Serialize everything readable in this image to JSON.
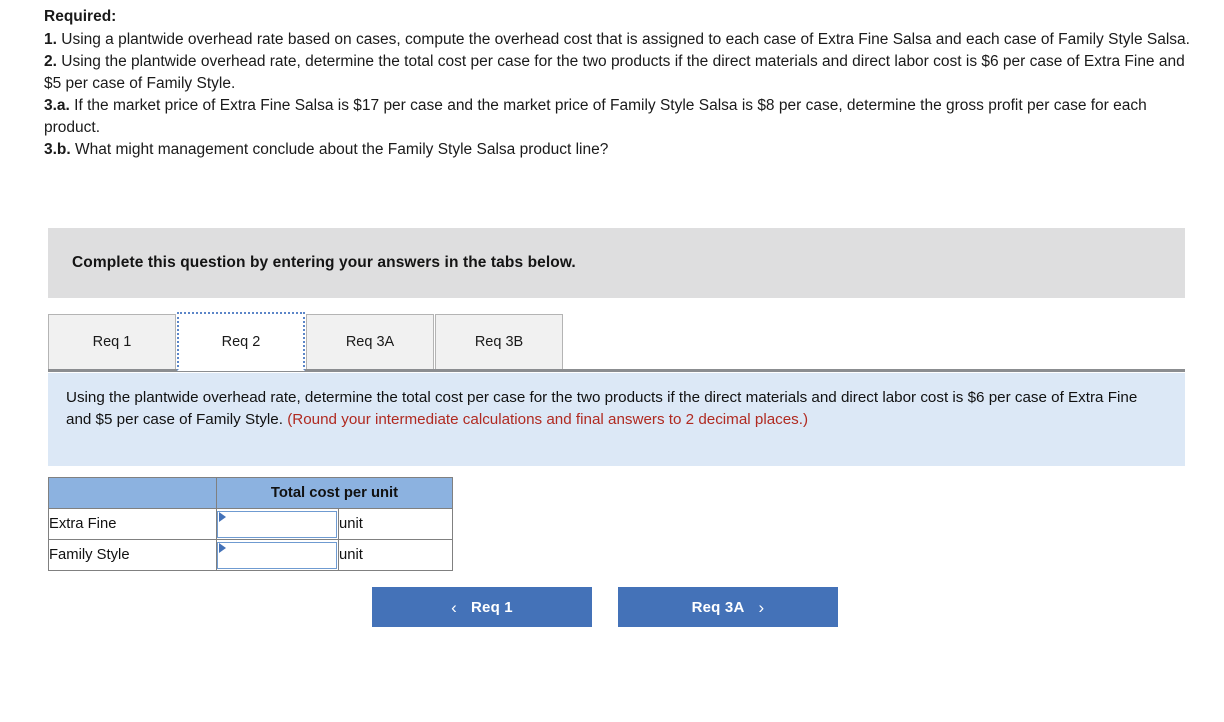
{
  "required": {
    "heading": "Required:",
    "lines": [
      {
        "num": "1.",
        "text": " Using a plantwide overhead rate based on cases, compute the overhead cost that is assigned to each case of Extra Fine Salsa and each case of Family Style Salsa."
      },
      {
        "num": "2.",
        "text": " Using the plantwide overhead rate, determine the total cost per case for the two products if the direct materials and direct labor cost is $6 per case of Extra Fine and $5 per case of Family Style."
      },
      {
        "num": "3.a.",
        "text": " If the market price of Extra Fine Salsa is $17 per case and the market price of Family Style Salsa is $8 per case, determine the gross profit per case for each product."
      },
      {
        "num": "3.b.",
        "text": " What might management conclude about the Family Style Salsa product line?"
      }
    ]
  },
  "banner": {
    "text": "Complete this question by entering your answers in the tabs below."
  },
  "tabs": [
    {
      "label": "Req 1",
      "active": false
    },
    {
      "label": "Req 2",
      "active": true
    },
    {
      "label": "Req 3A",
      "active": false
    },
    {
      "label": "Req 3B",
      "active": false
    }
  ],
  "question_panel": {
    "text_main": "Using the plantwide overhead rate, determine the total cost per case for the two products if the direct materials and direct labor cost is $6 per case of Extra Fine and $5 per case of Family Style.",
    "text_note": "(Round your intermediate calculations and final answers to 2 decimal places.)"
  },
  "answer_table": {
    "header_blank": "",
    "header_total": "Total cost per unit",
    "rows": [
      {
        "label": "Extra Fine",
        "value": "",
        "unit": "unit"
      },
      {
        "label": "Family Style",
        "value": "",
        "unit": "unit"
      }
    ]
  },
  "nav": {
    "prev_label": "Req 1",
    "prev_chevron": "‹",
    "next_label": "Req 3A",
    "next_chevron": "›"
  },
  "colors": {
    "banner_gray": "#dededf",
    "panel_blue": "#dce8f6",
    "table_header_blue": "#8cb2e0",
    "button_blue": "#4472b8",
    "note_red": "#b02a21",
    "tab_inactive": "#f1f1f1",
    "tab_active_border": "#5c86c8"
  }
}
